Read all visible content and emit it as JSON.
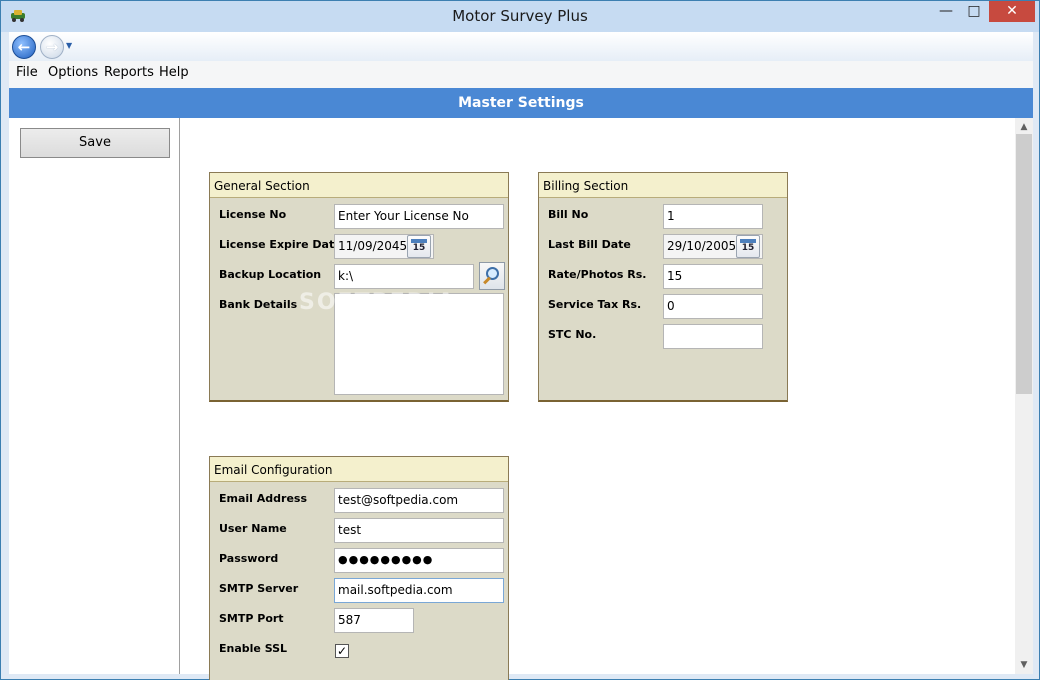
{
  "window": {
    "title": "Motor Survey Plus",
    "minimize": "—",
    "maximize": "□",
    "close": "✕"
  },
  "nav": {
    "back": "←",
    "forward": "→",
    "dropdown": "▼"
  },
  "menu": [
    "File",
    "Options",
    "Reports",
    "Help"
  ],
  "header": {
    "title": "Master Settings"
  },
  "sidebar": {
    "save_label": "Save"
  },
  "watermark": "SOFTPEDIA",
  "general": {
    "title": "General Section",
    "license_no_label": "License No",
    "license_no_value": "Enter Your License No",
    "license_expire_label": "License Expire Date",
    "license_expire_value": "11/09/2045",
    "backup_location_label": "Backup Location",
    "backup_location_value": "k:\\",
    "bank_details_label": "Bank Details",
    "bank_details_value": ""
  },
  "billing": {
    "title": "Billing Section",
    "bill_no_label": "Bill No",
    "bill_no_value": "1",
    "last_bill_date_label": "Last Bill Date",
    "last_bill_date_value": "29/10/2005",
    "rate_photos_label": "Rate/Photos Rs.",
    "rate_photos_value": "15",
    "service_tax_label": "Service Tax Rs.",
    "service_tax_value": "0",
    "stc_no_label": "STC No.",
    "stc_no_value": ""
  },
  "email": {
    "title": "Email Configuration",
    "address_label": "Email Address",
    "address_value": "test@softpedia.com",
    "user_name_label": "User Name",
    "user_name_value": "test",
    "password_label": "Password",
    "password_value": "●●●●●●●●●",
    "smtp_server_label": "SMTP Server",
    "smtp_server_value": "mail.softpedia.com",
    "smtp_port_label": "SMTP Port",
    "smtp_port_value": "587",
    "enable_ssl_label": "Enable SSL",
    "enable_ssl_check": "✓"
  },
  "calendar_icon_text": "15",
  "scroll": {
    "up": "▲",
    "down": "▼"
  }
}
